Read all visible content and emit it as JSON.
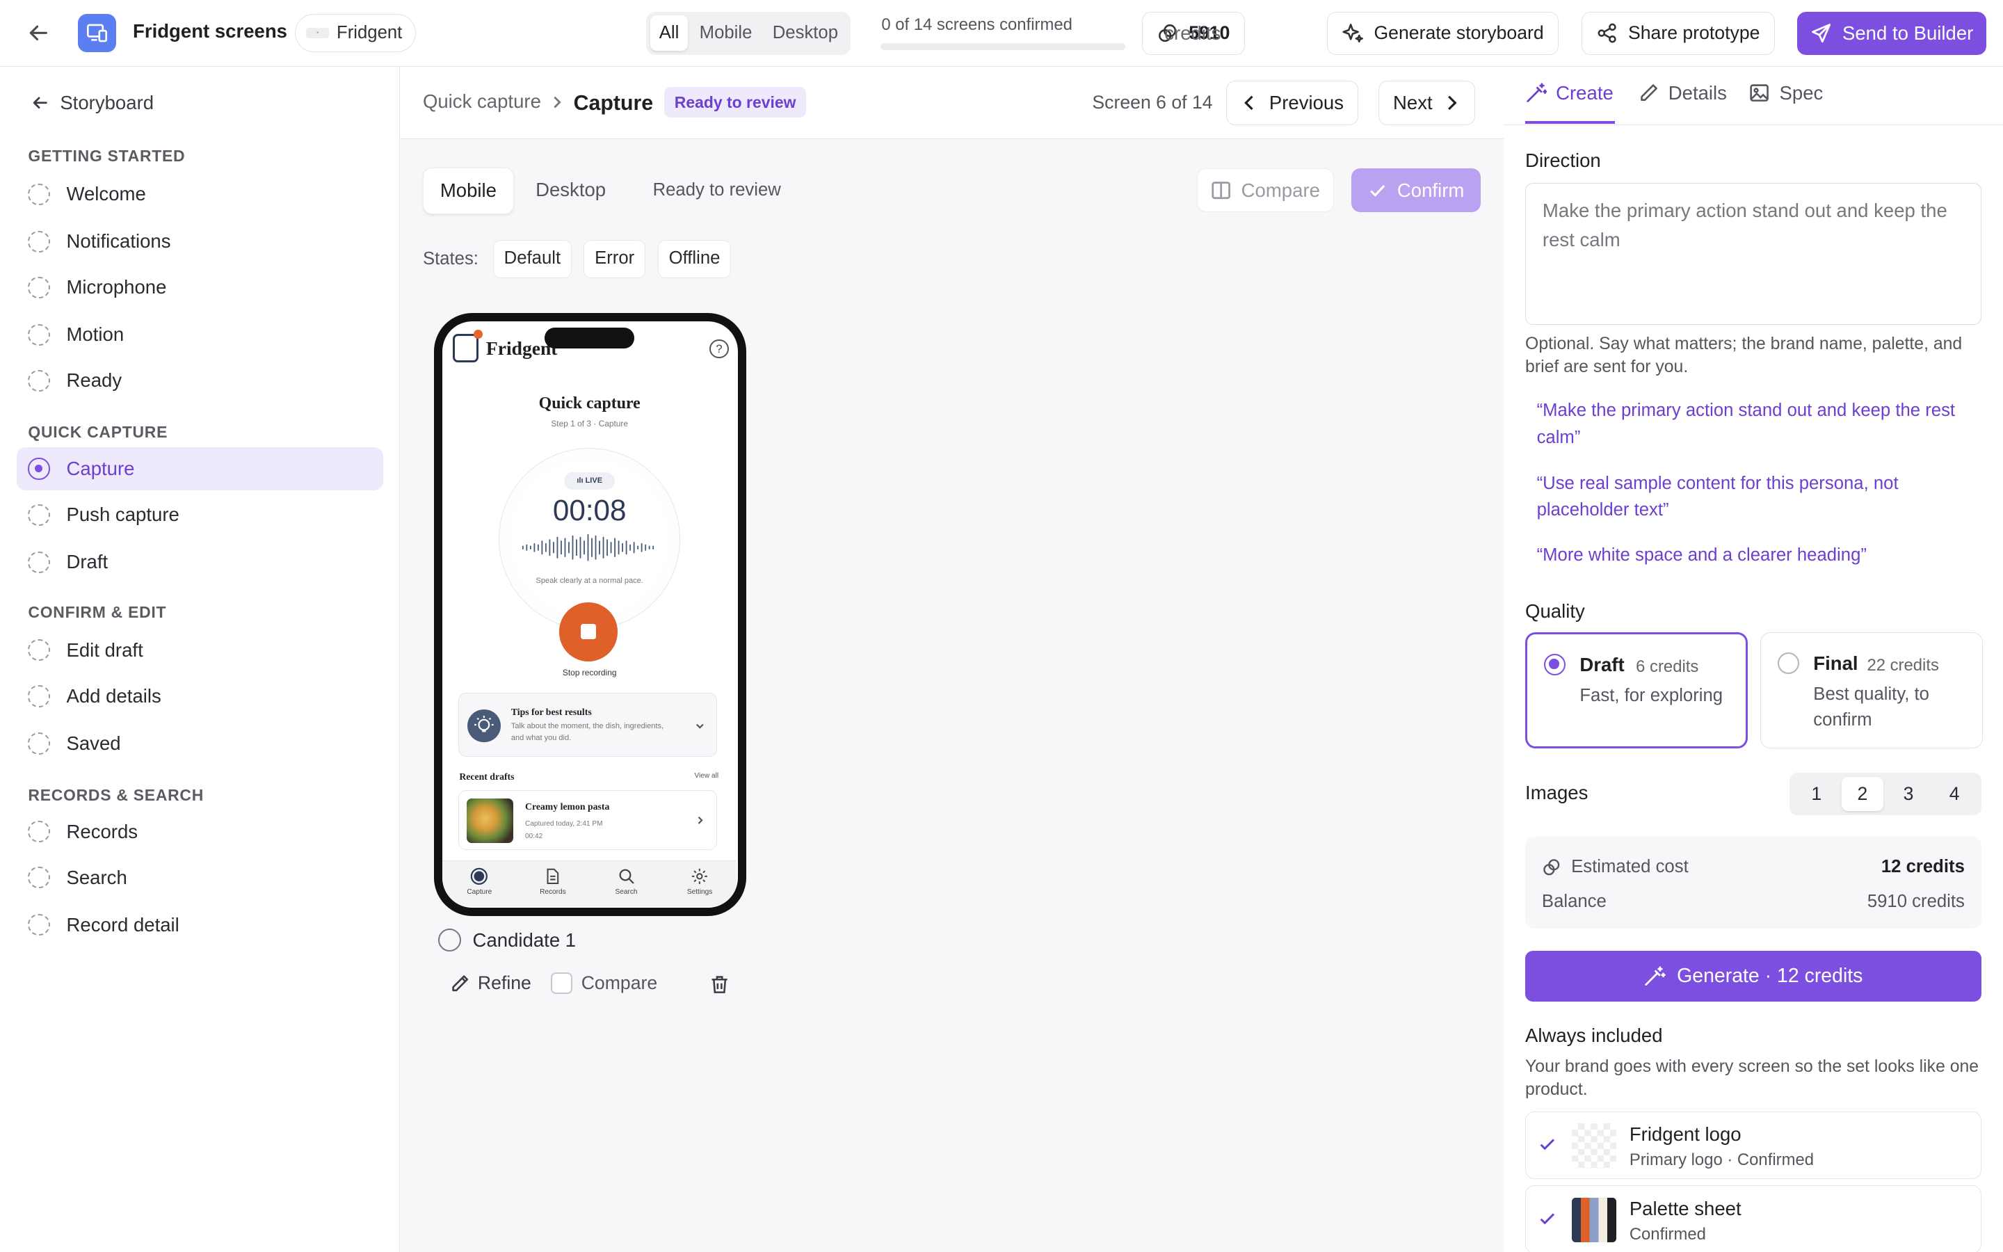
{
  "header": {
    "app_title": "Fridgent screens",
    "brand_chip": "Fridgent",
    "filter_tabs": [
      "All",
      "Mobile",
      "Desktop"
    ],
    "confirmed_status": "0 of 14 screens confirmed",
    "confirmed_progress": 0,
    "credits_value": "5910",
    "credits_label": "credits",
    "generate_storyboard": "Generate storyboard",
    "share_prototype": "Share prototype",
    "send_to_builder": "Send to Builder"
  },
  "sidebar": {
    "back_label": "Storyboard",
    "sections": [
      {
        "title": "GETTING STARTED",
        "items": [
          "Welcome",
          "Notifications",
          "Microphone",
          "Motion",
          "Ready"
        ]
      },
      {
        "title": "QUICK CAPTURE",
        "items": [
          "Capture",
          "Push capture",
          "Draft"
        ]
      },
      {
        "title": "CONFIRM & EDIT",
        "items": [
          "Edit draft",
          "Add details",
          "Saved"
        ]
      },
      {
        "title": "RECORDS & SEARCH",
        "items": [
          "Records",
          "Search",
          "Record detail"
        ]
      }
    ],
    "selected": "Capture"
  },
  "main": {
    "breadcrumb_parent": "Quick capture",
    "breadcrumb_current": "Capture",
    "status_badge": "Ready to review",
    "screen_position": "Screen 6 of 14",
    "previous": "Previous",
    "next": "Next",
    "device_tabs": [
      "Mobile",
      "Desktop"
    ],
    "ready_text": "Ready to review",
    "compare": "Compare",
    "confirm": "Confirm",
    "states_label": "States:",
    "states": [
      "Default",
      "Error",
      "Offline"
    ],
    "candidate_label": "Candidate 1",
    "refine": "Refine",
    "compare_check": "Compare"
  },
  "phone": {
    "brand": "Fridgent",
    "help": "?",
    "title": "Quick capture",
    "step": "Step 1 of 3 · Capture",
    "live": "LIVE",
    "timer": "00:08",
    "speak_hint": "Speak clearly at a normal pace.",
    "stop_label": "Stop recording",
    "tips_title": "Tips for best results",
    "tips_text": "Talk about the moment, the dish, ingredients, and what you did.",
    "recent_title": "Recent drafts",
    "view_all": "View all",
    "draft_title": "Creamy lemon pasta",
    "draft_time": "Captured today, 2:41 PM",
    "draft_duration": "00:42",
    "tabs": [
      "Capture",
      "Records",
      "Search",
      "Settings"
    ]
  },
  "panel": {
    "tabs": [
      "Create",
      "Details",
      "Spec"
    ],
    "direction_label": "Direction",
    "direction_value": "Make the primary action stand out and keep the rest calm",
    "direction_hint": "Optional. Say what matters; the brand name, palette, and brief are sent for you.",
    "suggestions": [
      "“Make the primary action stand out and keep the rest calm”",
      "“Use real sample content for this persona, not placeholder text”",
      "“More white space and a clearer heading”"
    ],
    "quality_label": "Quality",
    "quality_options": [
      {
        "name": "Draft",
        "credits": "6 credits",
        "desc": "Fast, for exploring"
      },
      {
        "name": "Final",
        "credits": "22 credits",
        "desc": "Best quality, to confirm"
      }
    ],
    "images_label": "Images",
    "images_options": [
      "1",
      "2",
      "3",
      "4"
    ],
    "images_selected": "2",
    "estimated_cost_label": "Estimated cost",
    "estimated_cost_value": "12 credits",
    "balance_label": "Balance",
    "balance_value": "5910 credits",
    "generate_button": "Generate · 12 credits",
    "always_included_label": "Always included",
    "always_included_hint": "Your brand goes with every screen so the set looks like one product.",
    "assets": [
      {
        "name": "Fridgent logo",
        "sub": "Primary logo · Confirmed"
      },
      {
        "name": "Palette sheet",
        "sub": "Confirmed"
      }
    ]
  },
  "colors": {
    "accent": "#7c4fe0",
    "accent_light": "#efe9fc",
    "record": "#e0602a",
    "navy": "#2c3a55"
  }
}
